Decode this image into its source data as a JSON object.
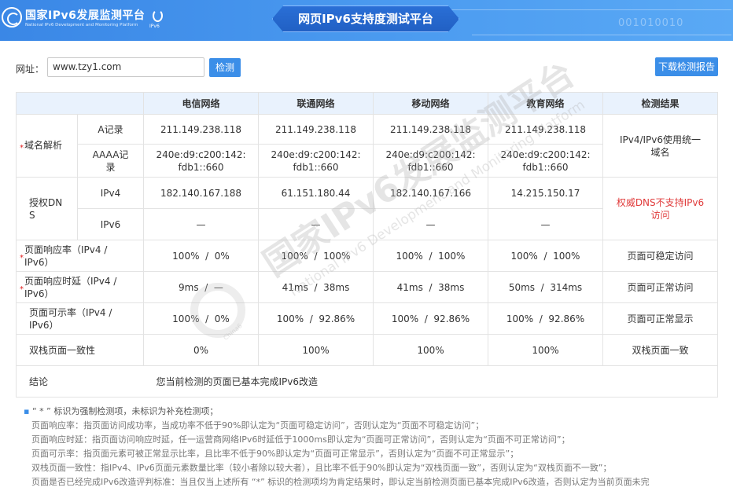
{
  "header": {
    "logo_title": "国家IPv6发展监测平台",
    "logo_subtitle": "National IPv6 Development and Monitoring Platform",
    "ipv6_mark": "IPv6",
    "banner_title": "网页IPv6支持度测试平台",
    "binary_text": "001010010"
  },
  "toolbar": {
    "url_label": "网址：",
    "url_value": "www.tzy1.com",
    "detect_button": "检测",
    "report_button": "下载检测报告"
  },
  "table": {
    "headers": [
      "电信网络",
      "联通网络",
      "移动网络",
      "教育网络",
      "检测结果"
    ],
    "domain_label": "域名解析",
    "a_record_label": "A记录",
    "a_record": [
      "211.149.238.118",
      "211.149.238.118",
      "211.149.238.118",
      "211.149.238.118"
    ],
    "aaaa_label": "AAAA记录",
    "aaaa_record": [
      "240e:d9:c200:142:fdb1::660",
      "240e:d9:c200:142:fdb1::660",
      "240e:d9:c200:142:fdb1::660",
      "240e:d9:c200:142:fdb1::660"
    ],
    "domain_result": "IPv4/IPv6使用统一域名",
    "dns_label": "授权DNS",
    "ipv4_label": "IPv4",
    "dns_ipv4": [
      "182.140.167.188",
      "61.151.180.44",
      "182.140.167.166",
      "14.215.150.17"
    ],
    "ipv6_label": "IPv6",
    "dns_ipv6": [
      "—",
      "—",
      "—",
      "—"
    ],
    "dns_result": "权威DNS不支持IPv6访问",
    "resp_rate_label": "页面响应率（IPv4 / IPv6）",
    "resp_rate": [
      "100%  /  0%",
      "100%  /  100%",
      "100%  /  100%",
      "100%  /  100%"
    ],
    "resp_rate_result": "页面可稳定访问",
    "delay_label": "页面响应时延（IPv4 / IPv6）",
    "delay": [
      "9ms  /  —",
      "41ms  /  38ms",
      "41ms  /  38ms",
      "50ms  /  314ms"
    ],
    "delay_result": "页面可正常访问",
    "visible_label": "页面可示率（IPv4 / IPv6）",
    "visible": [
      "100%  /  0%",
      "100%  /  92.86%",
      "100%  /  92.86%",
      "100%  /  92.86%"
    ],
    "visible_result": "页面可正常显示",
    "consistency_label": "双栈页面一致性",
    "consistency": [
      "0%",
      "100%",
      "100%",
      "100%"
    ],
    "consistency_result": "双栈页面一致",
    "conclusion_label": "结论",
    "conclusion": "您当前检测的页面已基本完成IPv6改造",
    "star": "*"
  },
  "watermark": {
    "text": "国家IPv6发展监测平台",
    "sub": "National IPv6 Development and Monitoring Platform",
    "circle": "China6"
  },
  "notes": {
    "first": "“ * ” 标识为强制检测项，未标识为补充检测项；",
    "lines": [
      "页面响应率：指页面访问成功率，当成功率不低于90%即认定为“页面可稳定访问”，否则认定为“页面不可稳定访问”；",
      "页面响应时延：指页面访问响应时延，任一运营商网络IPv6时延低于1000ms即认定为“页面可正常访问”，否则认定为“页面不可正常访问”；",
      "页面可示率：指页面元素可被正常显示比率，且比率不低于90%即认定为“页面可正常显示”，否则认定为“页面不可正常显示”；",
      "双栈页面一致性：指IPv4、IPv6页面元素数量比率（较小者除以较大者），且比率不低于90%即认定为“双栈页面一致”，否则认定为“双栈页面不一致”；",
      "页面是否已经完成IPv6改造评判标准：当且仅当上述所有 “*” 标识的检测项均为肯定结果时，即认定当前检测页面已基本完成IPv6改造，否则认定为当前页面未完"
    ]
  },
  "colors": {
    "header_blue": "#3a87e6",
    "button_blue": "#3b8ee8",
    "table_header_bg": "#e9f2fd",
    "warning_red": "#e03a3a"
  }
}
